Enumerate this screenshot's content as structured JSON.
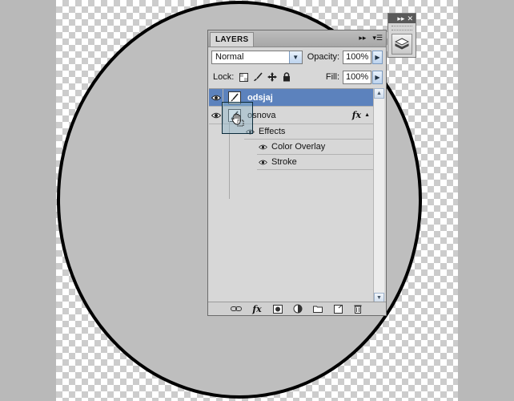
{
  "panel": {
    "tab_label": "LAYERS",
    "blend_mode": "Normal",
    "opacity_label": "Opacity:",
    "opacity_value": "100%",
    "lock_label": "Lock:",
    "fill_label": "Fill:",
    "fill_value": "100%"
  },
  "layers": [
    {
      "name": "odsjaj",
      "selected": true,
      "visible": true
    },
    {
      "name": "osnova",
      "selected": false,
      "visible": true,
      "fx_badge": "fx"
    }
  ],
  "effects": {
    "header": "Effects",
    "items": [
      "Color Overlay",
      "Stroke"
    ]
  },
  "footer": {
    "fx_label": "fx"
  },
  "icons": {
    "link": "link-icon",
    "fx": "fx-icon",
    "mask": "mask-icon",
    "adjustment": "adjustment-icon",
    "group": "folder-icon",
    "new_layer": "new-layer-icon",
    "delete": "trash-icon"
  },
  "colors": {
    "selection": "#5c82bd",
    "panel_bg": "#d7d7d7",
    "canvas_circle": "#bebebe"
  }
}
